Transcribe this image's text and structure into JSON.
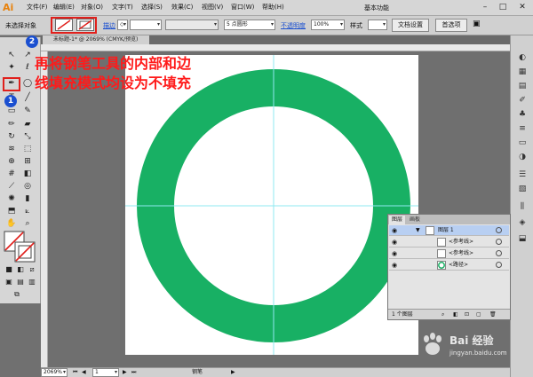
{
  "app": {
    "logo": "Ai",
    "menu": [
      "文件(F)",
      "编辑(E)",
      "对象(O)",
      "文字(T)",
      "选择(S)",
      "效果(C)",
      "视图(V)",
      "窗口(W)",
      "帮助(H)"
    ],
    "workspace": "基本功能",
    "window_buttons": {
      "minimize": "–",
      "maximize": "□",
      "close": "✕"
    }
  },
  "control_bar": {
    "no_selection": "未选择对象",
    "stroke_label": "描边",
    "stroke_spinner": "◇",
    "brush_value": "5 点圆形",
    "opacity_label": "不透明度",
    "opacity_value": "100%",
    "style_label": "样式",
    "document_setup": "文档设置",
    "preferences": "首选项"
  },
  "document": {
    "tab_title": "未标题-1* @ 2069% (CMYK/预览)",
    "zoom": "2069%",
    "page": "1",
    "status": "钢笔"
  },
  "canvas": {
    "ring_color": "#18b064",
    "guide_color": "#8fe8f0"
  },
  "annotation": {
    "line1": "再将钢笔工具的内部和边",
    "line2": "线填充模式均设为不填充",
    "step1": "1",
    "step2": "2",
    "highlight_color": "#e0201c"
  },
  "layers_panel": {
    "tab_layers": "图层",
    "tab_artboards": "画板",
    "rows": [
      {
        "name": "图层 1",
        "expand": "▼"
      },
      {
        "name": "<参考线>"
      },
      {
        "name": "<参考线>"
      },
      {
        "name": "<路径>"
      }
    ],
    "count": "1 个图层"
  },
  "watermark": {
    "text": "Bai 经验",
    "url": "jingyan.baidu.com"
  }
}
